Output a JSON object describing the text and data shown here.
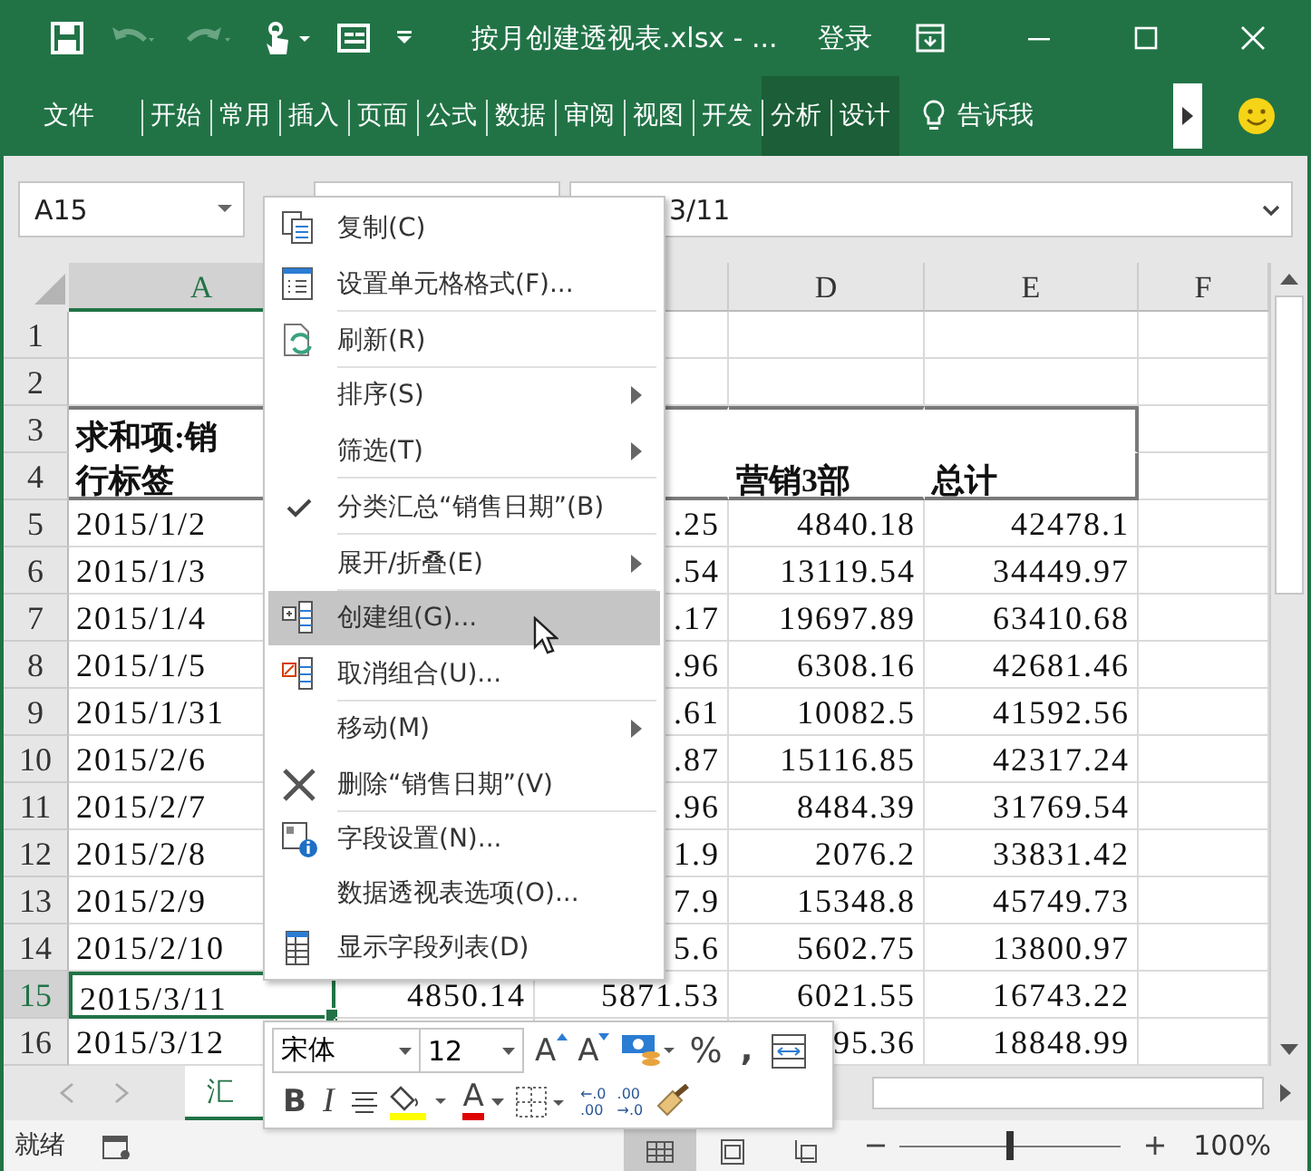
{
  "window": {
    "title": "按月创建透视表.xlsx - ...",
    "sign_in": "登录"
  },
  "ribbon": {
    "tabs": [
      {
        "label": "文件",
        "selected": false,
        "contextual": false
      },
      {
        "label": "开始",
        "selected": false,
        "contextual": false
      },
      {
        "label": "常用",
        "selected": false,
        "contextual": false
      },
      {
        "label": "插入",
        "selected": false,
        "contextual": false
      },
      {
        "label": "页面",
        "selected": false,
        "contextual": false
      },
      {
        "label": "公式",
        "selected": false,
        "contextual": false
      },
      {
        "label": "数据",
        "selected": false,
        "contextual": false
      },
      {
        "label": "审阅",
        "selected": false,
        "contextual": false
      },
      {
        "label": "视图",
        "selected": false,
        "contextual": false
      },
      {
        "label": "开发",
        "selected": false,
        "contextual": false
      },
      {
        "label": "分析",
        "selected": false,
        "contextual": true
      },
      {
        "label": "设计",
        "selected": false,
        "contextual": true
      }
    ],
    "tell_me": "告诉我"
  },
  "formula_bar": {
    "name_box": "A15",
    "value": "3/11"
  },
  "sheet": {
    "column_headers": {
      "a": {
        "label": "A",
        "selected": true
      },
      "d": {
        "label": "D",
        "selected": false
      },
      "e": {
        "label": "E",
        "selected": false
      },
      "f": {
        "label": "F",
        "selected": false
      }
    },
    "rows": [
      {
        "number": "1",
        "kind": "blank",
        "selected": false
      },
      {
        "number": "2",
        "kind": "blank",
        "selected": false
      },
      {
        "number": "3",
        "kind": "pivot-header",
        "selected": false,
        "a": "求和项:销"
      },
      {
        "number": "4",
        "kind": "pivot-header",
        "selected": false,
        "a": "行标签",
        "d": "营销3部",
        "e": "总计"
      },
      {
        "number": "5",
        "kind": "data",
        "selected": false,
        "a": "2015/1/2",
        "c": ".25",
        "d": "4840.18",
        "e": "42478.1"
      },
      {
        "number": "6",
        "kind": "data",
        "selected": false,
        "a": "2015/1/3",
        "c": ".54",
        "d": "13119.54",
        "e": "34449.97"
      },
      {
        "number": "7",
        "kind": "data",
        "selected": false,
        "a": "2015/1/4",
        "c": ".17",
        "d": "19697.89",
        "e": "63410.68"
      },
      {
        "number": "8",
        "kind": "data",
        "selected": false,
        "a": "2015/1/5",
        "c": ".96",
        "d": "6308.16",
        "e": "42681.46"
      },
      {
        "number": "9",
        "kind": "data",
        "selected": false,
        "a": "2015/1/31",
        "c": ".61",
        "d": "10082.5",
        "e": "41592.56"
      },
      {
        "number": "10",
        "kind": "data",
        "selected": false,
        "a": "2015/2/6",
        "c": ".87",
        "d": "15116.85",
        "e": "42317.24"
      },
      {
        "number": "11",
        "kind": "data",
        "selected": false,
        "a": "2015/2/7",
        "c": ".96",
        "d": "8484.39",
        "e": "31769.54"
      },
      {
        "number": "12",
        "kind": "data",
        "selected": false,
        "a": "2015/2/8",
        "c": "1.9",
        "d": "2076.2",
        "e": "33831.42"
      },
      {
        "number": "13",
        "kind": "data",
        "selected": false,
        "a": "2015/2/9",
        "c": "7.9",
        "d": "15348.8",
        "e": "45749.73"
      },
      {
        "number": "14",
        "kind": "data",
        "selected": false,
        "a": "2015/2/10",
        "c": "5.6",
        "d": "5602.75",
        "e": "13800.97"
      },
      {
        "number": "15",
        "kind": "data",
        "selected": true,
        "a": "2015/3/11",
        "b": "4850.14",
        "c": "5871.53",
        "d": "6021.55",
        "e": "16743.22"
      },
      {
        "number": "16",
        "kind": "data",
        "selected": false,
        "a": "2015/3/12",
        "d": "95.36",
        "e": "18848.99"
      }
    ],
    "tabs": [
      {
        "label": "汇",
        "selected": true
      }
    ]
  },
  "context_menu": {
    "items": [
      {
        "label": "复制(C)",
        "checked": false,
        "submenu": false,
        "selected": false,
        "separator_after": false
      },
      {
        "label": "设置单元格格式(F)...",
        "checked": false,
        "submenu": false,
        "selected": false,
        "separator_after": true
      },
      {
        "label": "刷新(R)",
        "checked": false,
        "submenu": false,
        "selected": false,
        "separator_after": true
      },
      {
        "label": "排序(S)",
        "checked": false,
        "submenu": true,
        "selected": false,
        "separator_after": false
      },
      {
        "label": "筛选(T)",
        "checked": false,
        "submenu": true,
        "selected": false,
        "separator_after": true
      },
      {
        "label": "分类汇总“销售日期”(B)",
        "checked": true,
        "submenu": false,
        "selected": false,
        "separator_after": true
      },
      {
        "label": "展开/折叠(E)",
        "checked": false,
        "submenu": true,
        "selected": false,
        "separator_after": true
      },
      {
        "label": "创建组(G)...",
        "checked": false,
        "submenu": false,
        "selected": true,
        "separator_after": false
      },
      {
        "label": "取消组合(U)...",
        "checked": false,
        "submenu": false,
        "selected": false,
        "separator_after": true
      },
      {
        "label": "移动(M)",
        "checked": false,
        "submenu": true,
        "selected": false,
        "separator_after": false
      },
      {
        "label": "删除“销售日期”(V)",
        "checked": false,
        "submenu": false,
        "selected": false,
        "separator_after": true
      },
      {
        "label": "字段设置(N)...",
        "checked": false,
        "submenu": false,
        "selected": false,
        "separator_after": false
      },
      {
        "label": "数据透视表选项(O)...",
        "checked": false,
        "submenu": false,
        "selected": false,
        "separator_after": false
      },
      {
        "label": "显示字段列表(D)",
        "checked": false,
        "submenu": false,
        "selected": false,
        "separator_after": false
      }
    ]
  },
  "mini_toolbar": {
    "font": "宋体",
    "size": "12",
    "grow_font": "A",
    "shrink_font": "A",
    "percent": "%",
    "comma": ",",
    "bold": "B",
    "italic": "I",
    "font_color": "A",
    "increase_decimal": {
      "line_1": "←.0",
      "line_2": ".00"
    },
    "decrease_decimal": {
      "line_1": ".00",
      "line_2": "→.0"
    }
  },
  "status_bar": {
    "status": "就绪",
    "views": [
      {
        "selected": true
      },
      {
        "selected": false
      },
      {
        "selected": false
      }
    ],
    "zoom": {
      "level": 0.5,
      "reading": "100%"
    }
  }
}
